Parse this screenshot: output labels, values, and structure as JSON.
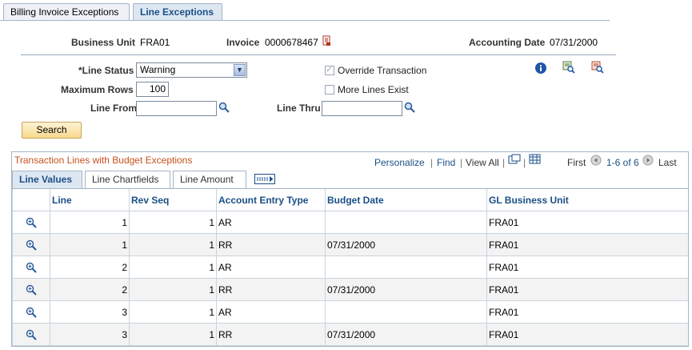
{
  "tabs": [
    {
      "label": "Billing Invoice Exceptions",
      "active": false
    },
    {
      "label": "Line Exceptions",
      "active": true
    }
  ],
  "header": {
    "business_unit_label": "Business Unit",
    "business_unit": "FRA01",
    "invoice_label": "Invoice",
    "invoice": "0000678467",
    "accounting_date_label": "Accounting Date",
    "accounting_date": "07/31/2000"
  },
  "criteria": {
    "line_status_label": "*Line Status",
    "line_status": "Warning",
    "max_rows_label": "Maximum Rows",
    "max_rows": "100",
    "line_from_label": "Line From",
    "line_from": "",
    "line_thru_label": "Line Thru",
    "line_thru": "",
    "override_label": "Override Transaction",
    "override_checked": true,
    "more_lines_label": "More Lines Exist",
    "more_lines_checked": false,
    "search_label": "Search"
  },
  "grid": {
    "title": "Transaction Lines with Budget Exceptions",
    "personalize": "Personalize",
    "find": "Find",
    "view_all": "View All",
    "first": "First",
    "range": "1-6 of 6",
    "last": "Last",
    "subtabs": [
      "Line Values",
      "Line Chartfields",
      "Line Amount"
    ],
    "columns": [
      "Line",
      "Rev Seq",
      "Account Entry Type",
      "Budget Date",
      "GL Business Unit"
    ],
    "rows": [
      {
        "line": "1",
        "rev_seq": "1",
        "entry_type": "AR",
        "budget_date": "",
        "gl_bu": "FRA01"
      },
      {
        "line": "1",
        "rev_seq": "1",
        "entry_type": "RR",
        "budget_date": "07/31/2000",
        "gl_bu": "FRA01"
      },
      {
        "line": "2",
        "rev_seq": "1",
        "entry_type": "AR",
        "budget_date": "",
        "gl_bu": "FRA01"
      },
      {
        "line": "2",
        "rev_seq": "1",
        "entry_type": "RR",
        "budget_date": "07/31/2000",
        "gl_bu": "FRA01"
      },
      {
        "line": "3",
        "rev_seq": "1",
        "entry_type": "AR",
        "budget_date": "",
        "gl_bu": "FRA01"
      },
      {
        "line": "3",
        "rev_seq": "1",
        "entry_type": "RR",
        "budget_date": "07/31/2000",
        "gl_bu": "FRA01"
      }
    ]
  },
  "colors": {
    "accent": "#1b4f86",
    "grid_title": "#c7511d",
    "button": "#f7d88e"
  }
}
